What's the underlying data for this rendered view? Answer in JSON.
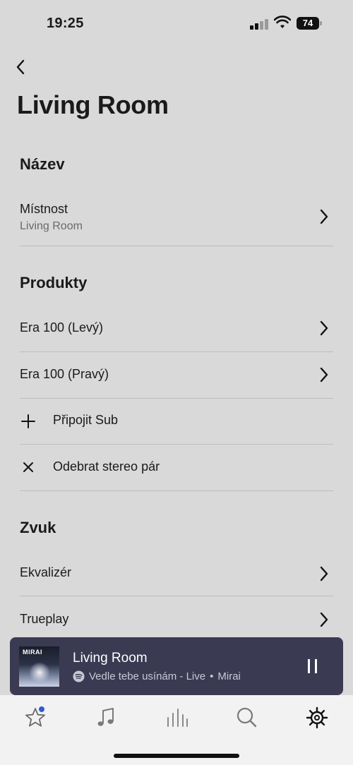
{
  "status_bar": {
    "time": "19:25",
    "battery_percent": "74",
    "icons": [
      "signal-icon",
      "wifi-icon",
      "battery-icon"
    ]
  },
  "header": {
    "back_icon": "chevron-left-icon",
    "title": "Living Room"
  },
  "sections": {
    "name": {
      "heading": "Název",
      "rows": [
        {
          "label": "Místnost",
          "value": "Living Room",
          "icon": "chevron-right-icon"
        }
      ]
    },
    "products": {
      "heading": "Produkty",
      "rows": [
        {
          "label": "Era 100 (Levý)",
          "icon": "chevron-right-icon"
        },
        {
          "label": "Era 100 (Pravý)",
          "icon": "chevron-right-icon"
        },
        {
          "label": "Připojit Sub",
          "icon": "plus-icon"
        },
        {
          "label": "Odebrat stereo pár",
          "icon": "close-icon"
        }
      ]
    },
    "sound": {
      "heading": "Zvuk",
      "rows": [
        {
          "label": "Ekvalizér",
          "icon": "chevron-right-icon"
        },
        {
          "label": "Trueplay",
          "icon": "chevron-right-icon"
        }
      ]
    }
  },
  "now_playing": {
    "room": "Living Room",
    "track": "Vedle tebe usínám - Live",
    "separator": "•",
    "artist": "Mirai",
    "album_art_text": "MIRAI",
    "source_icon": "spotify-icon",
    "control_icon": "pause-icon",
    "background_color": "#3a3a52"
  },
  "tab_bar": {
    "tabs": [
      {
        "icon": "star-icon",
        "badge": true,
        "badge_color": "#2f5bd6"
      },
      {
        "icon": "music-note-icon"
      },
      {
        "icon": "equalizer-bars-icon"
      },
      {
        "icon": "search-icon"
      },
      {
        "icon": "gear-icon",
        "active": true
      }
    ]
  },
  "colors": {
    "background": "#d9d9d9",
    "tab_bar": "#f2f2f2",
    "divider": "#bdbdbd",
    "secondary_text": "#6a6a6a"
  }
}
